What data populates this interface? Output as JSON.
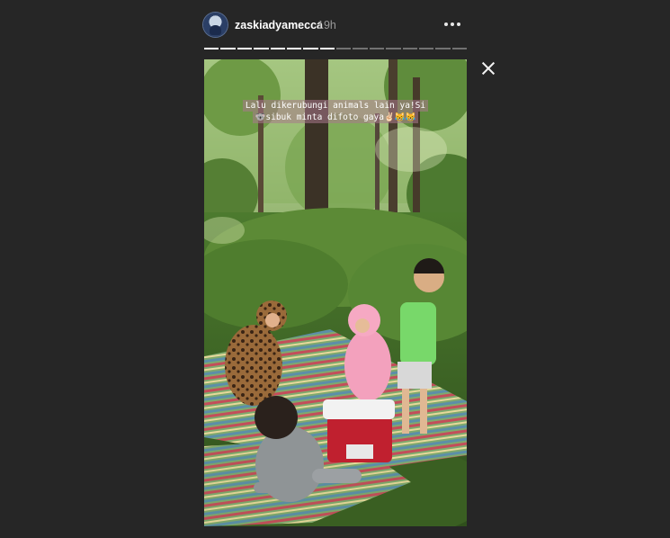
{
  "header": {
    "username": "zaskiadyamecca",
    "timestamp": "19h",
    "avatar_icon": "profile-avatar",
    "more_icon": "more-options-icon"
  },
  "progress": {
    "segments_total": 16,
    "segments_viewed": 8
  },
  "controls": {
    "close_icon": "close-icon"
  },
  "story": {
    "caption_line1": "Lalu dikerubungi animals lain ya!Si",
    "caption_line2": "🐨sibuk minta difoto gaya✌🏻😹😹"
  },
  "colors": {
    "background": "#262626",
    "text": "#ffffff",
    "muted": "#9a9a9a"
  }
}
